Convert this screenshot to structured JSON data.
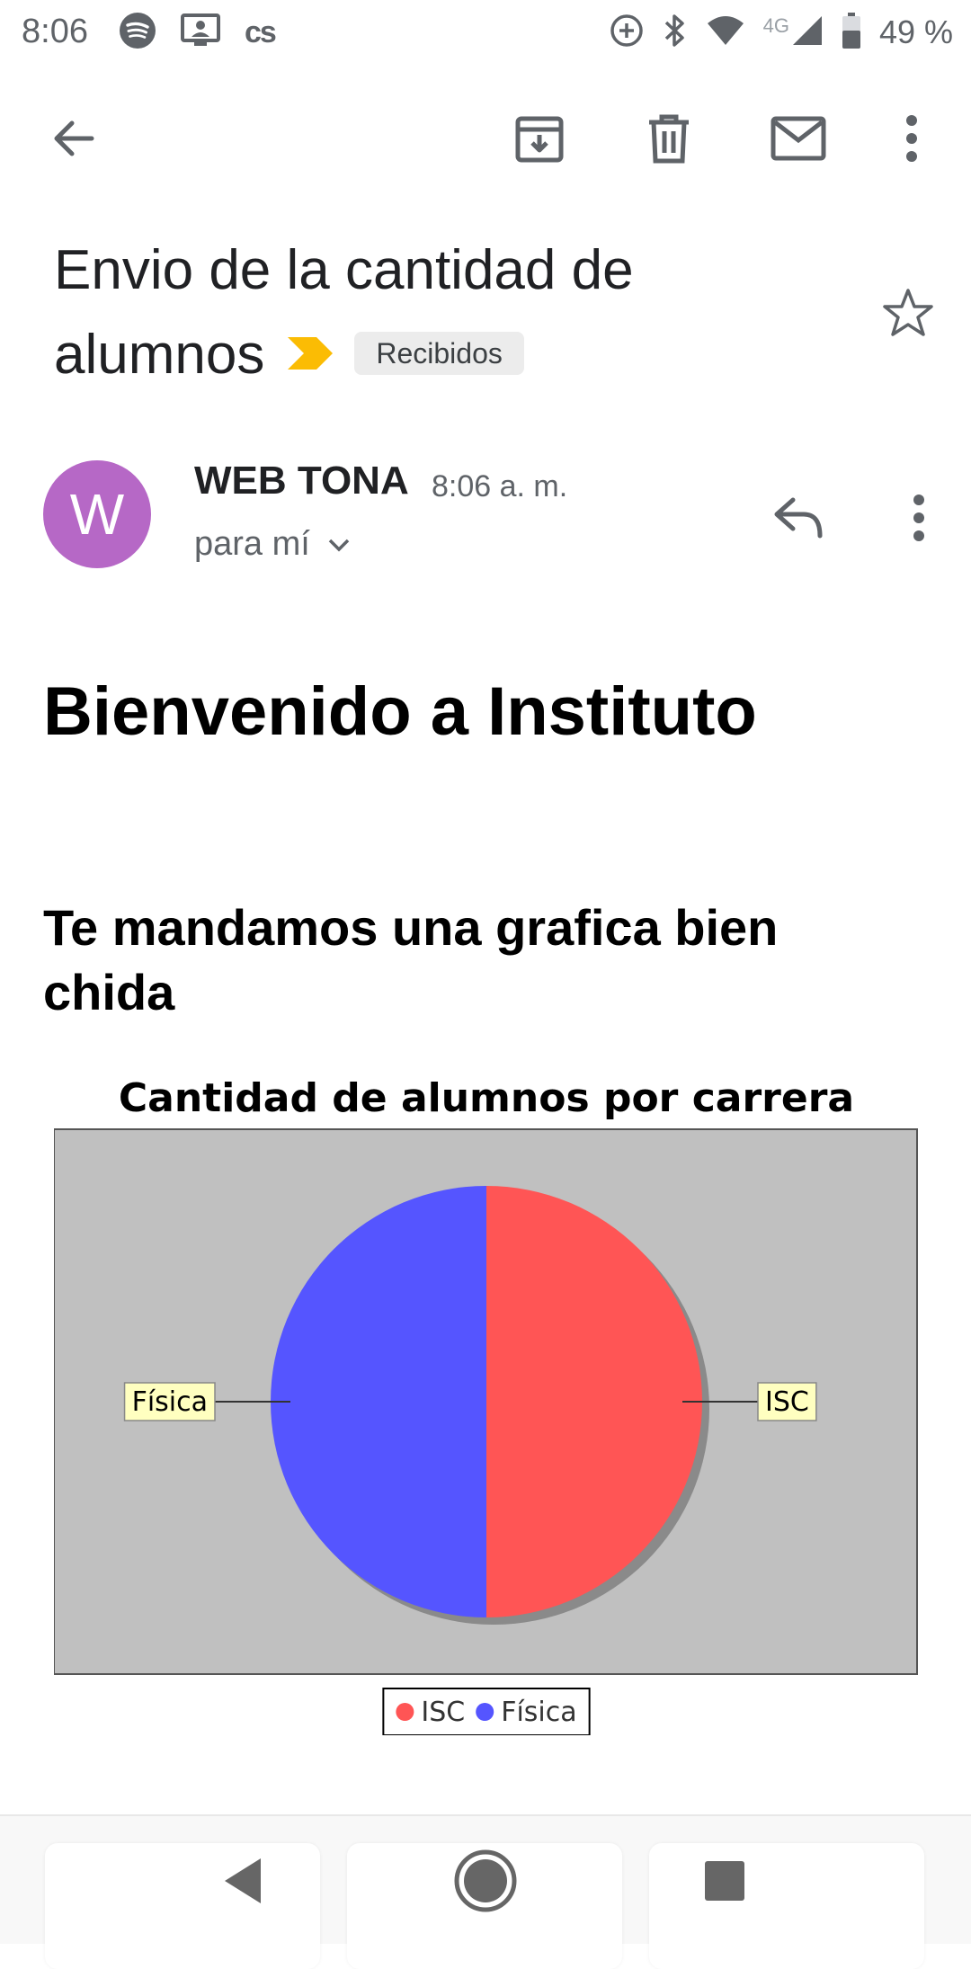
{
  "status_bar": {
    "time": "8:06",
    "network": "4G",
    "battery": "49 %",
    "icons": [
      "spotify-icon",
      "screencast-icon",
      "cs-app-icon",
      "data-saver-icon",
      "bluetooth-icon",
      "wifi-icon",
      "signal-icon",
      "battery-icon"
    ],
    "cs_label": "cs"
  },
  "toolbar": {
    "back": "back-arrow-icon",
    "archive": "archive-icon",
    "delete": "trash-icon",
    "mark_unread": "mail-icon",
    "more": "more-vert-icon"
  },
  "email": {
    "subject": "Envio de la cantidad de alumnos",
    "label": "Recibidos",
    "important_color": "#fbbc04",
    "sender": {
      "initial": "W",
      "avatar_color": "#b668c6",
      "name": "WEB TONA",
      "time": "8:06 a. m.",
      "recipient": "para mí"
    },
    "body": {
      "heading": "Bienvenido a Instituto",
      "subheading": "Te mandamos una grafica bien chida"
    }
  },
  "chart_data": {
    "type": "pie",
    "title": "Cantidad de alumnos por carrera",
    "categories": [
      "ISC",
      "Física"
    ],
    "values": [
      50,
      50
    ],
    "colors": [
      "#ff5555",
      "#5555ff"
    ],
    "background": "#c0c0c0",
    "legend": {
      "placement": "bottom",
      "entries": [
        "ISC",
        "Física"
      ]
    },
    "slice_labels": [
      "ISC",
      "Física"
    ]
  },
  "nav_bar": {
    "back": "nav-back-icon",
    "home": "nav-home-icon",
    "recents": "nav-recents-icon"
  }
}
